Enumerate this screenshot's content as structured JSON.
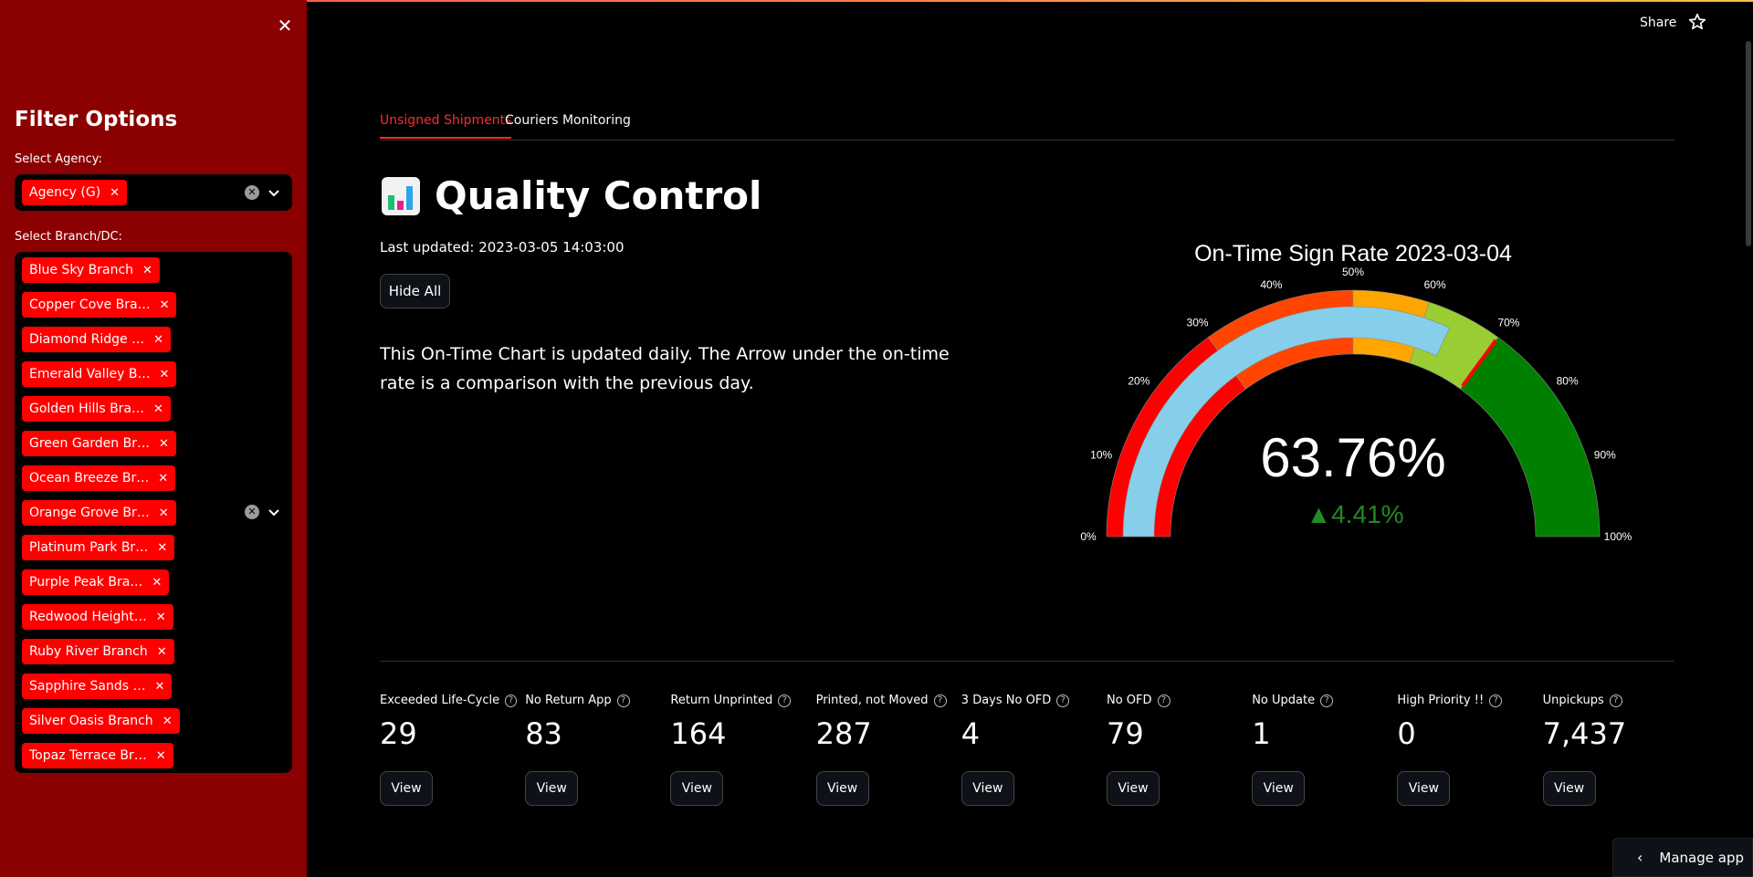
{
  "sidebar": {
    "title": "Filter Options",
    "agency_label": "Select Agency:",
    "agency_tags": [
      "Agency (G)"
    ],
    "branch_label": "Select Branch/DC:",
    "branch_tags": [
      "Blue Sky Branch",
      "Copper Cove Bra…",
      "Diamond Ridge …",
      "Emerald Valley B…",
      "Golden Hills Bra…",
      "Green Garden Br…",
      "Ocean Breeze Br…",
      "Orange Grove Br…",
      "Platinum Park Br…",
      "Purple Peak Bra…",
      "Redwood Height…",
      "Ruby River Branch",
      "Sapphire Sands …",
      "Silver Oasis Branch",
      "Topaz Terrace Br…"
    ]
  },
  "header": {
    "share_label": "Share"
  },
  "tabs": [
    {
      "label": "Unsigned Shipments",
      "active": true
    },
    {
      "label": "Couriers Monitoring",
      "active": false
    }
  ],
  "main": {
    "title": "Quality Control",
    "last_updated": "Last updated: 2023-03-05 14:03:00",
    "hide_all_label": "Hide All",
    "description": "This On-Time Chart is updated daily. The Arrow under the on-time rate is a comparison with the previous day."
  },
  "gauge": {
    "title": "On-Time Sign Rate 2023-03-04",
    "value_text": "63.76%",
    "delta_text": "▲4.41%",
    "value": 63.76,
    "threshold": 70,
    "ticks": [
      "0%",
      "10%",
      "20%",
      "30%",
      "40%",
      "50%",
      "60%",
      "70%",
      "80%",
      "90%",
      "100%"
    ],
    "colors": {
      "bar": "#87ceeb",
      "red": "#ff0000",
      "orangered": "#ff4500",
      "orange": "#ffa500",
      "yellowgreen": "#9acd32",
      "green": "#008000",
      "delta": "#228b22"
    }
  },
  "metrics": [
    {
      "label": "Exceeded Life-Cycle",
      "value": "29",
      "button": "View"
    },
    {
      "label": "No Return App",
      "value": "83",
      "button": "View"
    },
    {
      "label": "Return Unprinted",
      "value": "164",
      "button": "View"
    },
    {
      "label": "Printed, not Moved",
      "value": "287",
      "button": "View"
    },
    {
      "label": "3 Days No OFD",
      "value": "4",
      "button": "View"
    },
    {
      "label": "No OFD",
      "value": "79",
      "button": "View"
    },
    {
      "label": "No Update",
      "value": "1",
      "button": "View"
    },
    {
      "label": "High Priority !!",
      "value": "0",
      "button": "View"
    },
    {
      "label": "Unpickups",
      "value": "7,437",
      "button": "View"
    }
  ],
  "footer": {
    "manage_label": "Manage app"
  }
}
